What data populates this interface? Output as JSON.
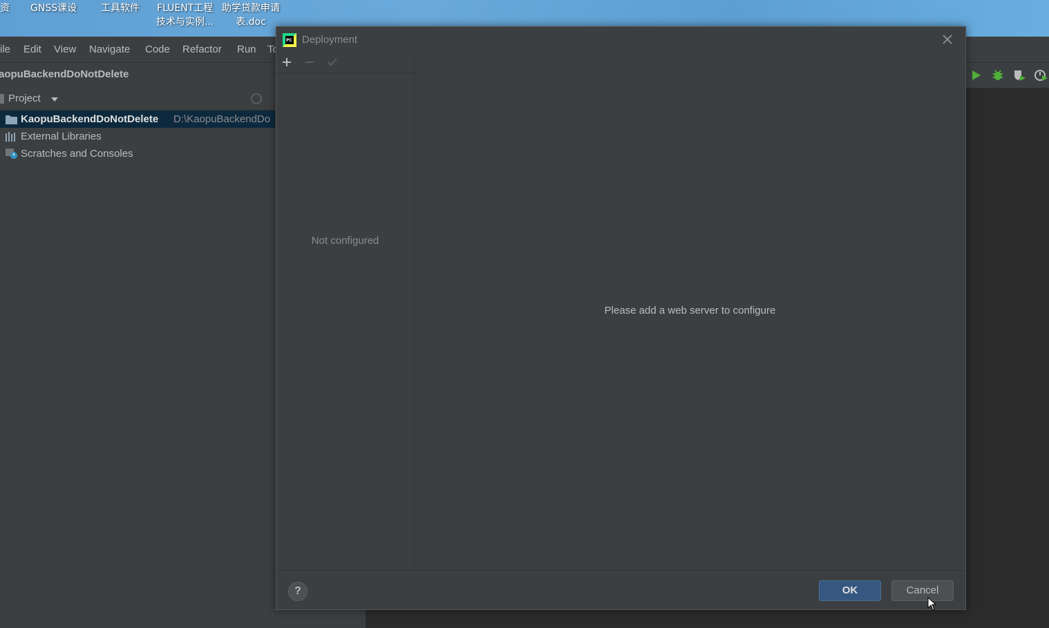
{
  "desktop": {
    "icons": [
      {
        "label": "资"
      },
      {
        "label": "GNSS课设"
      },
      {
        "label": "工具软件"
      },
      {
        "label": "FLUENT工程\n技术与实例..."
      },
      {
        "label": "助学贷款申请\n表.doc"
      }
    ]
  },
  "ide": {
    "menu": [
      "ile",
      "Edit",
      "View",
      "Navigate",
      "Code",
      "Refactor",
      "Run",
      "To"
    ],
    "project_name": "aopuBackendDoNotDelete",
    "project_panel": {
      "title": "Project",
      "tree": [
        {
          "label": "KaopuBackendDoNotDelete",
          "path": "D:\\KaopuBackendDo",
          "icon": "folder-icon",
          "selected": true
        },
        {
          "label": "External Libraries",
          "icon": "libraries-icon",
          "selected": false
        },
        {
          "label": "Scratches and Consoles",
          "icon": "scratches-icon",
          "selected": false
        }
      ]
    }
  },
  "dialog": {
    "title": "Deployment",
    "left_empty_text": "Not configured",
    "main_empty_text": "Please add a web server to configure",
    "buttons": {
      "ok": "OK",
      "cancel": "Cancel",
      "help": "?"
    }
  },
  "colors": {
    "background": "#3c3f41",
    "editor": "#2b2b2b",
    "selection": "#0d293e",
    "ok_button": "#365880",
    "run_green": "#4fb038"
  }
}
